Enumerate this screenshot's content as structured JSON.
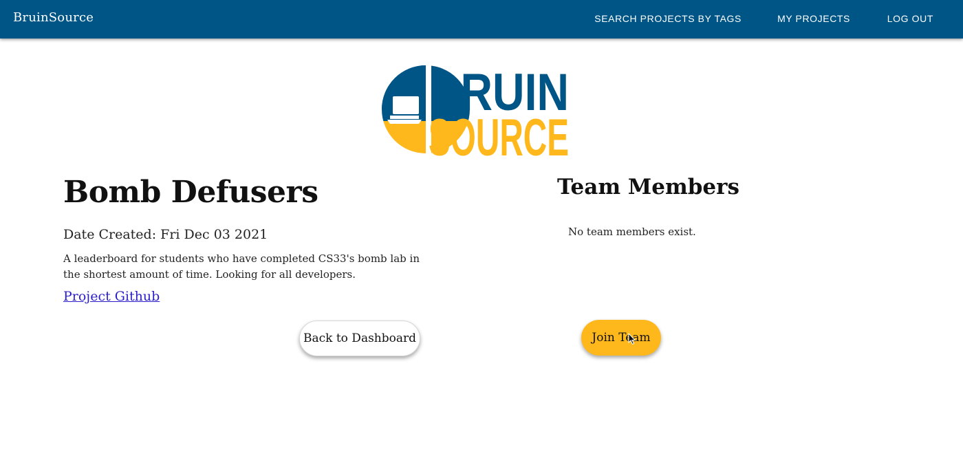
{
  "navbar": {
    "brand": "BruinSource",
    "links": [
      {
        "label": "SEARCH PROJECTS BY TAGS"
      },
      {
        "label": "MY PROJECTS"
      },
      {
        "label": "LOG OUT"
      }
    ]
  },
  "logo": {
    "line1": "BRUIN",
    "line2": "SOURCE",
    "colors": {
      "blue": "#005587",
      "gold": "#ffb81c"
    }
  },
  "project": {
    "title": "Bomb Defusers",
    "date_created": "Date Created: Fri Dec 03 2021",
    "description": "A leaderboard for students who have completed CS33's bomb lab in the shortest amount of time. Looking for all developers.",
    "github_link": "Project Github"
  },
  "team": {
    "title": "Team Members",
    "empty_message": "No team members exist."
  },
  "buttons": {
    "back": "Back to Dashboard",
    "join": "Join Team"
  },
  "colors": {
    "navbar": "#005587",
    "accent": "#ffb81c",
    "link": "#2a1ec8"
  }
}
